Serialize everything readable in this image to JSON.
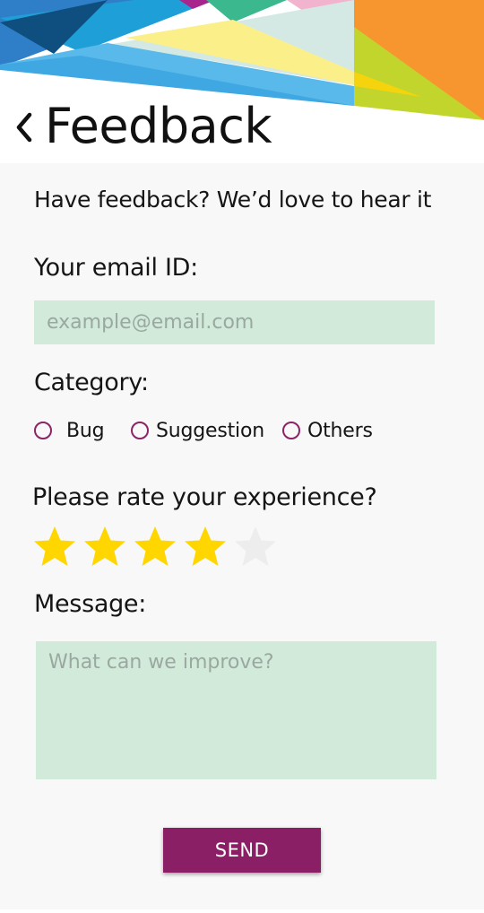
{
  "header": {
    "title": "Feedback",
    "back_icon": "chevron-left-icon"
  },
  "intro_text": "Have feedback? We’d love to hear it",
  "email": {
    "label": "Your email ID:",
    "placeholder": "example@email.com",
    "value": ""
  },
  "category": {
    "label": "Category:",
    "options": [
      {
        "label": "Bug",
        "selected": false
      },
      {
        "label": "Suggestion",
        "selected": false
      },
      {
        "label": "Others",
        "selected": false
      }
    ]
  },
  "rating": {
    "label": "Please rate your experience?",
    "value": 4,
    "max": 5,
    "filled_color": "#ffd600",
    "empty_color": "#ededed"
  },
  "message": {
    "label": "Message:",
    "placeholder": "What can we improve?",
    "value": ""
  },
  "send_button": {
    "label": "SEND"
  },
  "colors": {
    "accent": "#8b1f66",
    "input_bg": "#d2eada",
    "page_bg": "#f8f8f8"
  }
}
